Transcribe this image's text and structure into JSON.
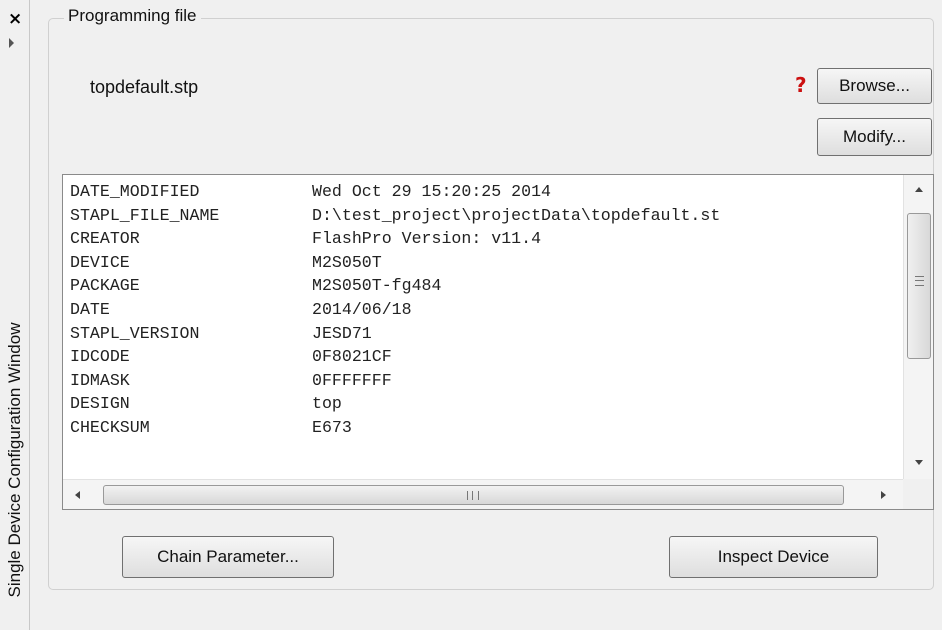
{
  "window": {
    "title": "Single Device Configuration Window",
    "close_glyph": "×"
  },
  "group": {
    "title": "Programming file"
  },
  "file": {
    "name": "topdefault.stp",
    "help_glyph": "?"
  },
  "buttons": {
    "browse": "Browse...",
    "modify": "Modify...",
    "chain_parameter": "Chain Parameter...",
    "inspect_device": "Inspect Device"
  },
  "file_info": {
    "rows": [
      {
        "key": "DATE_MODIFIED",
        "value": "Wed Oct 29 15:20:25 2014"
      },
      {
        "key": "STAPL_FILE_NAME",
        "value": "D:\\test_project\\projectData\\topdefault.st"
      },
      {
        "key": "CREATOR",
        "value": "FlashPro Version: v11.4"
      },
      {
        "key": "DEVICE",
        "value": "M2S050T"
      },
      {
        "key": "PACKAGE",
        "value": "M2S050T-fg484"
      },
      {
        "key": "DATE",
        "value": "2014/06/18"
      },
      {
        "key": "STAPL_VERSION",
        "value": "JESD71"
      },
      {
        "key": "IDCODE",
        "value": "0F8021CF"
      },
      {
        "key": "IDMASK",
        "value": "0FFFFFFF"
      },
      {
        "key": "DESIGN",
        "value": "top"
      },
      {
        "key": "CHECKSUM",
        "value": "E673"
      }
    ]
  },
  "colors": {
    "help_icon": "#cc1010",
    "panel_bg": "#f0f0f0",
    "viewer_bg": "#ffffff"
  }
}
